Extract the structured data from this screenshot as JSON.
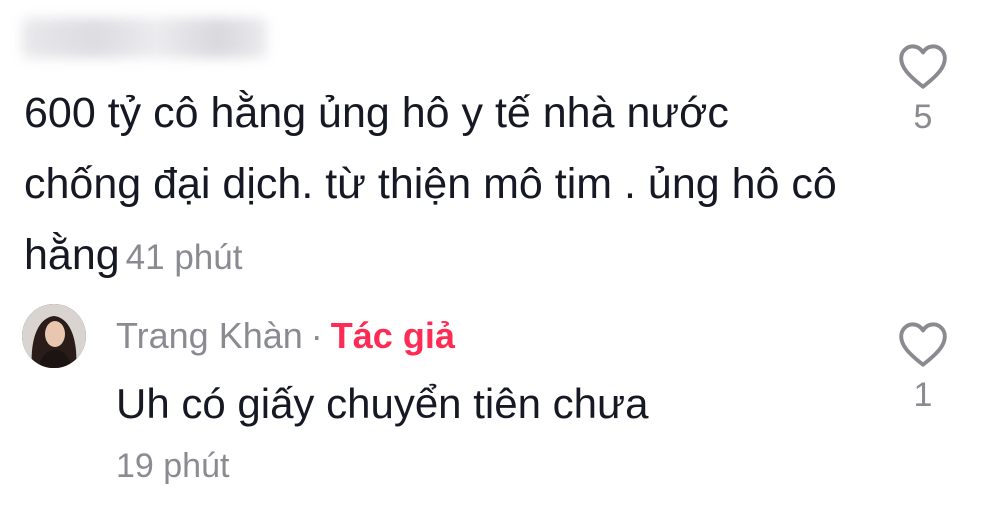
{
  "comment": {
    "text": "600 tỷ cô hằng ủng hô y tế nhà nước chống đại dịch. từ thiện mô tim . ủng hô cô hằng",
    "time": "41 phút",
    "like_count": "5",
    "like_icon": "heart-outline-icon"
  },
  "reply": {
    "username": "Trang Khàn",
    "separator": "·",
    "author_badge": "Tác giả",
    "text": "Uh có giấy chuyển tiên chưa",
    "time": "19 phút",
    "like_count": "1",
    "like_icon": "heart-outline-icon"
  },
  "colors": {
    "text_primary": "#161823",
    "text_secondary": "#8a8b91",
    "author_badge": "#fe2c55"
  }
}
